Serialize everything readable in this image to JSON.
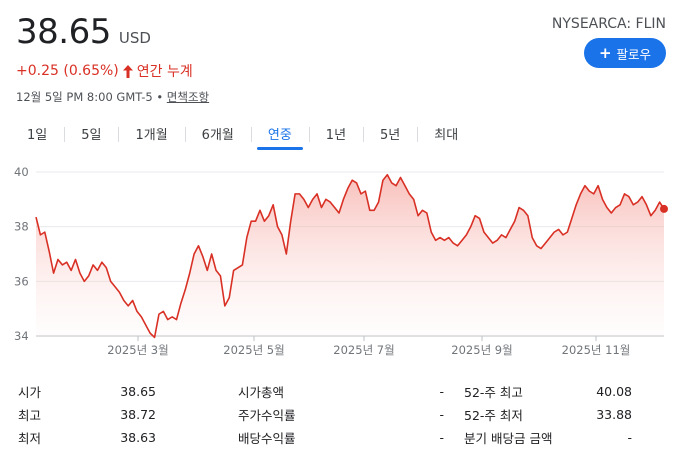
{
  "quote": {
    "price": "38.65",
    "currency": "USD",
    "ticker": "NYSEARCA: FLIN",
    "follow_label": "팔로우",
    "change": "+0.25 (0.65%)",
    "change_period": "연간 누계",
    "timestamp": "12월 5일 PM 8:00 GMT-5 • ",
    "disclaimer": "면책조항",
    "accent_color": "#1a73e8",
    "down_color": "#d93025"
  },
  "tabs": [
    {
      "label": "1일"
    },
    {
      "label": "5일"
    },
    {
      "label": "1개월"
    },
    {
      "label": "6개월"
    },
    {
      "label": "연중",
      "active": true
    },
    {
      "label": "1년"
    },
    {
      "label": "5년"
    },
    {
      "label": "최대"
    }
  ],
  "chart_data": {
    "type": "area",
    "y_ticks": [
      "40",
      "38",
      "36",
      "34"
    ],
    "ylim": [
      34,
      40
    ],
    "x_tick_labels": [
      "2025년 3월",
      "2025년 5월",
      "2025년 7월",
      "2025년 9월",
      "2025년 11월"
    ],
    "line_color": "#d93025",
    "y": [
      38.35,
      37.7,
      37.8,
      37.1,
      36.3,
      36.8,
      36.6,
      36.7,
      36.4,
      36.8,
      36.3,
      36.0,
      36.2,
      36.6,
      36.4,
      36.7,
      36.5,
      36.0,
      35.8,
      35.6,
      35.3,
      35.1,
      35.3,
      34.9,
      34.7,
      34.4,
      34.1,
      33.95,
      34.8,
      34.9,
      34.6,
      34.7,
      34.6,
      35.2,
      35.7,
      36.3,
      37.0,
      37.3,
      36.9,
      36.4,
      37.0,
      36.4,
      36.2,
      35.1,
      35.4,
      36.4,
      36.5,
      36.6,
      37.6,
      38.2,
      38.2,
      38.6,
      38.2,
      38.4,
      38.8,
      38.0,
      37.7,
      37.0,
      38.2,
      39.2,
      39.2,
      39.0,
      38.7,
      39.0,
      39.2,
      38.7,
      39.0,
      38.9,
      38.7,
      38.5,
      39.0,
      39.4,
      39.7,
      39.6,
      39.2,
      39.3,
      38.6,
      38.6,
      38.9,
      39.7,
      39.9,
      39.6,
      39.5,
      39.8,
      39.5,
      39.2,
      39.0,
      38.4,
      38.6,
      38.5,
      37.8,
      37.5,
      37.6,
      37.5,
      37.6,
      37.4,
      37.3,
      37.5,
      37.7,
      38.0,
      38.4,
      38.3,
      37.8,
      37.6,
      37.4,
      37.5,
      37.7,
      37.6,
      37.9,
      38.2,
      38.7,
      38.6,
      38.4,
      37.6,
      37.3,
      37.2,
      37.4,
      37.6,
      37.8,
      37.9,
      37.7,
      37.8,
      38.3,
      38.8,
      39.2,
      39.5,
      39.3,
      39.2,
      39.5,
      39.0,
      38.7,
      38.5,
      38.7,
      38.8,
      39.2,
      39.1,
      38.8,
      38.9,
      39.1,
      38.8,
      38.4,
      38.6,
      38.9,
      38.65
    ]
  },
  "stats": [
    [
      {
        "label": "시가",
        "value": "38.65"
      },
      {
        "label": "시가총액",
        "value": "-"
      },
      {
        "label": "52-주 최고",
        "value": "40.08"
      }
    ],
    [
      {
        "label": "최고",
        "value": "38.72"
      },
      {
        "label": "주가수익률",
        "value": "-"
      },
      {
        "label": "52-주 최저",
        "value": "33.88"
      }
    ],
    [
      {
        "label": "최저",
        "value": "38.63"
      },
      {
        "label": "배당수익률",
        "value": "-"
      },
      {
        "label": "분기 배당금 금액",
        "value": "-"
      }
    ]
  ]
}
